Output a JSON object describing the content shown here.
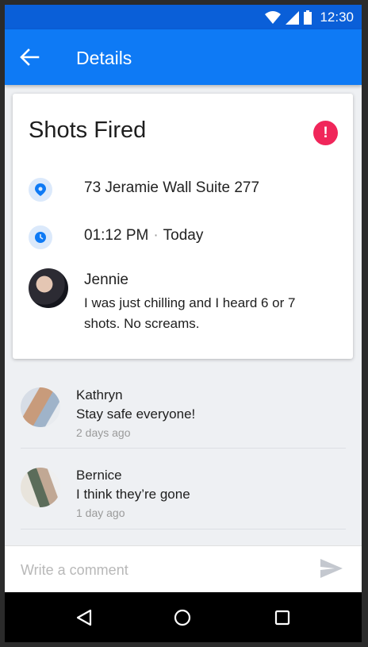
{
  "status_bar": {
    "time": "12:30"
  },
  "app_bar": {
    "title": "Details"
  },
  "incident": {
    "title": "Shots Fired",
    "address": "73 Jeramie Wall Suite 277",
    "time": "01:12 PM",
    "separator": "·",
    "day": "Today",
    "reporter": {
      "name": "Jennie",
      "message": "I was just chilling and I heard 6 or 7 shots. No screams."
    }
  },
  "comments": [
    {
      "name": "Kathryn",
      "text": "Stay safe everyone!",
      "time": "2 days ago"
    },
    {
      "name": "Bernice",
      "text": "I think they’re gone",
      "time": "1 day ago"
    }
  ],
  "comment_bar": {
    "placeholder": "Write a comment"
  },
  "colors": {
    "primary": "#0e7af5",
    "status_bar": "#0a5fd8",
    "alert": "#f0265a"
  },
  "icons": [
    "wifi-icon",
    "signal-icon",
    "battery-icon",
    "back-arrow-icon",
    "alert-icon",
    "location-pin-icon",
    "clock-icon",
    "send-icon",
    "nav-back-icon",
    "nav-home-icon",
    "nav-recent-icon"
  ]
}
